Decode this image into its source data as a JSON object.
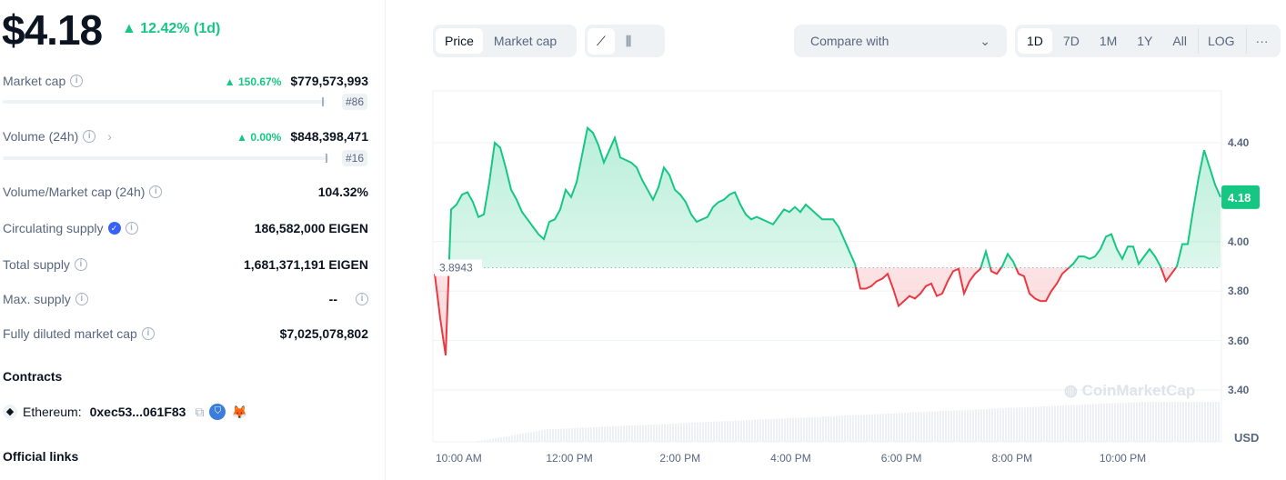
{
  "header": {
    "price": "$4.18",
    "change": "12.42% (1d)"
  },
  "stats": [
    {
      "label": "Market cap",
      "change": "150.67%",
      "value": "$779,573,993",
      "rank": "#86",
      "bar_fill": 0.88
    },
    {
      "label": "Volume (24h)",
      "change": "0.00%",
      "value": "$848,398,471",
      "rank": "#16",
      "bar_fill": 0.89
    },
    {
      "label": "Volume/Market cap (24h)",
      "value": "104.32%"
    },
    {
      "label": "Circulating supply",
      "value": "186,582,000 EIGEN"
    },
    {
      "label": "Total supply",
      "value": "1,681,371,191 EIGEN"
    },
    {
      "label": "Max. supply",
      "value": "--"
    },
    {
      "label": "Fully diluted market cap",
      "value": "$7,025,078,802"
    }
  ],
  "contracts": {
    "title": "Contracts",
    "chain": "Ethereum:",
    "address": "0xec53...061F83"
  },
  "links": {
    "title": "Official links"
  },
  "toolbar": {
    "tabs": [
      "Price",
      "Market cap"
    ],
    "compare": "Compare with",
    "ranges": [
      "1D",
      "7D",
      "1M",
      "1Y",
      "All"
    ],
    "log": "LOG",
    "more": "···"
  },
  "watermark": "CoinMarketCap",
  "colors": {
    "up": "#16c784",
    "down": "#ea3943"
  },
  "chart_data": {
    "type": "line",
    "time_range": [
      "09:34",
      "23:46"
    ],
    "baseline": 3.8943,
    "baseline_label": "3.8943",
    "current_label": "4.18",
    "ylim": [
      3.3,
      4.55
    ],
    "yticks": [
      "4.40",
      "4.00",
      "3.80",
      "3.60",
      "3.40"
    ],
    "ytick_values": [
      4.4,
      4.0,
      3.8,
      3.6,
      3.4
    ],
    "ylabel": "USD",
    "xticks": [
      "10:00 AM",
      "12:00 PM",
      "2:00 PM",
      "4:00 PM",
      "6:00 PM",
      "8:00 PM",
      "10:00 PM"
    ],
    "xtick_hours": [
      10,
      12,
      14,
      16,
      18,
      20,
      22
    ],
    "prices": [
      3.87,
      3.69,
      3.54,
      4.13,
      4.15,
      4.19,
      4.2,
      4.16,
      4.1,
      4.11,
      4.24,
      4.4,
      4.38,
      4.3,
      4.21,
      4.17,
      4.12,
      4.09,
      4.06,
      4.03,
      4.01,
      4.08,
      4.09,
      4.13,
      4.21,
      4.18,
      4.24,
      4.35,
      4.46,
      4.44,
      4.39,
      4.32,
      4.37,
      4.42,
      4.34,
      4.33,
      4.32,
      4.3,
      4.25,
      4.21,
      4.17,
      4.22,
      4.3,
      4.27,
      4.21,
      4.19,
      4.16,
      4.11,
      4.08,
      4.09,
      4.1,
      4.14,
      4.16,
      4.17,
      4.19,
      4.2,
      4.15,
      4.11,
      4.09,
      4.1,
      4.09,
      4.08,
      4.07,
      4.1,
      4.13,
      4.12,
      4.14,
      4.12,
      4.15,
      4.13,
      4.11,
      4.09,
      4.09,
      4.09,
      4.06,
      4.01,
      3.96,
      3.91,
      3.81,
      3.81,
      3.82,
      3.84,
      3.85,
      3.87,
      3.81,
      3.74,
      3.76,
      3.78,
      3.77,
      3.79,
      3.82,
      3.83,
      3.78,
      3.79,
      3.84,
      3.88,
      3.89,
      3.79,
      3.84,
      3.87,
      3.89,
      3.96,
      3.88,
      3.87,
      3.9,
      3.95,
      3.92,
      3.87,
      3.86,
      3.79,
      3.77,
      3.76,
      3.76,
      3.8,
      3.83,
      3.87,
      3.89,
      3.91,
      3.94,
      3.94,
      3.93,
      3.94,
      3.97,
      4.02,
      4.03,
      3.97,
      3.93,
      3.98,
      3.98,
      3.91,
      3.94,
      3.97,
      3.94,
      3.9,
      3.84,
      3.87,
      3.9,
      3.99,
      3.99,
      4.13,
      4.26,
      4.37,
      4.3,
      4.23,
      4.18
    ]
  }
}
